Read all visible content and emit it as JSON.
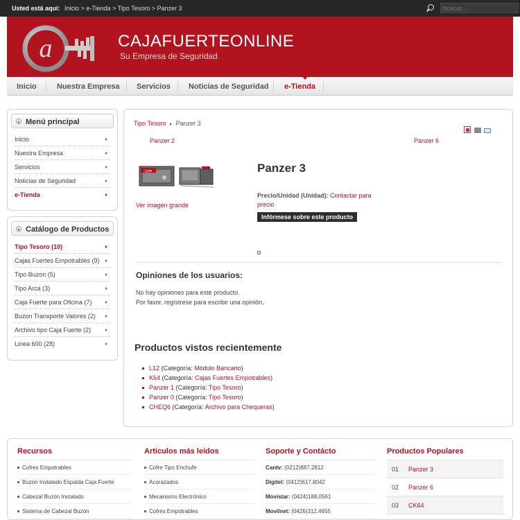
{
  "topbar": {
    "you_are_here": "Usted está aquí:",
    "crumbs": [
      "Inicio",
      "e-Tienda",
      "Tipo Tesoro",
      "Panzer 3"
    ],
    "separator": ">",
    "search_placeholder": "buscar..."
  },
  "header": {
    "title": "CAJAFUERTEONLINE",
    "slogan": "Su Empresa de Seguridad",
    "brand_color": "#b1141f"
  },
  "nav": {
    "items": [
      "Inicio",
      "Nuestra Empresa",
      "Servicios",
      "Noticias de Seguridad",
      "e-Tienda"
    ],
    "active": "e-Tienda"
  },
  "sidebar": {
    "main_menu": {
      "title": "Menú principal",
      "items": [
        "Inicio",
        "Nuestra Empresa",
        "Servicios",
        "Noticias de Seguridad",
        "e-Tienda"
      ]
    },
    "catalog": {
      "title": "Catálogo de Productos",
      "items": [
        "Tipo Tesoro (10)",
        "Cajas Fuertes Empotrables (9)",
        "Tipo Buzon (5)",
        "Tipo Arca (3)",
        "Caja Fuerte para Oficina (7)",
        "Buzon Transporte Valores (2)",
        "Archivo tipo Caja Fuerte (2)",
        "Linea 600 (28)"
      ]
    }
  },
  "content": {
    "breadcrumb_parent": "Tipo Tesoro",
    "breadcrumb_current": "Panzer 3",
    "prev_product": "Panzer 2",
    "next_product": "Panzer 6",
    "product_title": "Panzer 3",
    "view_large": "Ver imagen grande",
    "price_label": "Precio/Unidad (Unidad):",
    "price_value": "Contactar para precio",
    "info_button": "Infórmese sobre este producto",
    "reviews_title": "Opiniones de los usuarios:",
    "reviews_none": "No hay opiniones para este producto.",
    "reviews_register": "Por favor, regístrese para escribir una opinión.",
    "recent_title": "Productos vistos recientemente",
    "recent": [
      {
        "name": "L12",
        "cat_label": "(Categoría:",
        "cat": "Módulo Bancario",
        "close": ")"
      },
      {
        "name": "K64",
        "cat_label": "(Categoría:",
        "cat": "Cajas Fuertes Empotrables",
        "close": ")"
      },
      {
        "name": "Panzer 1",
        "cat_label": "(Categoría:",
        "cat": "Tipo Tesoro",
        "close": ")"
      },
      {
        "name": "Panzer 0",
        "cat_label": "(Categoría:",
        "cat": "Tipo Tesoro",
        "close": ")"
      },
      {
        "name": "CHEQ6",
        "cat_label": "(Categoría:",
        "cat": "Archivo para Chequeras",
        "close": ")"
      }
    ],
    "product_image_brand": "Lyon"
  },
  "footer": {
    "recursos": {
      "title": "Recursos",
      "items": [
        "Cofres Empotrables",
        "Buzón Instalado Espalda Caja Fuerte",
        "Cabezal Buzón Instalado",
        "Sistema de Cabezal Buzón"
      ]
    },
    "articulos": {
      "title": "Articulos más leídos",
      "items": [
        "Cofre Tipo Enchufe",
        "Acorazados",
        "Mecanismo Electrónico",
        "Cofres Empotrables"
      ]
    },
    "soporte": {
      "title": "Soporte y Contácto",
      "items": [
        {
          "label": "Cantv:",
          "value": "(0212)887.2812"
        },
        {
          "label": "Digitel:",
          "value": "(0412)617.8042"
        },
        {
          "label": "Movistar:",
          "value": "(0424)188.0561"
        },
        {
          "label": "Movilnet:",
          "value": "(0426)312.4655"
        }
      ]
    },
    "populares": {
      "title": "Productos Populares",
      "items": [
        {
          "num": "01",
          "name": "Panzer 3"
        },
        {
          "num": "02",
          "name": "Panzer 6"
        },
        {
          "num": "03",
          "name": "CK64"
        }
      ]
    }
  }
}
